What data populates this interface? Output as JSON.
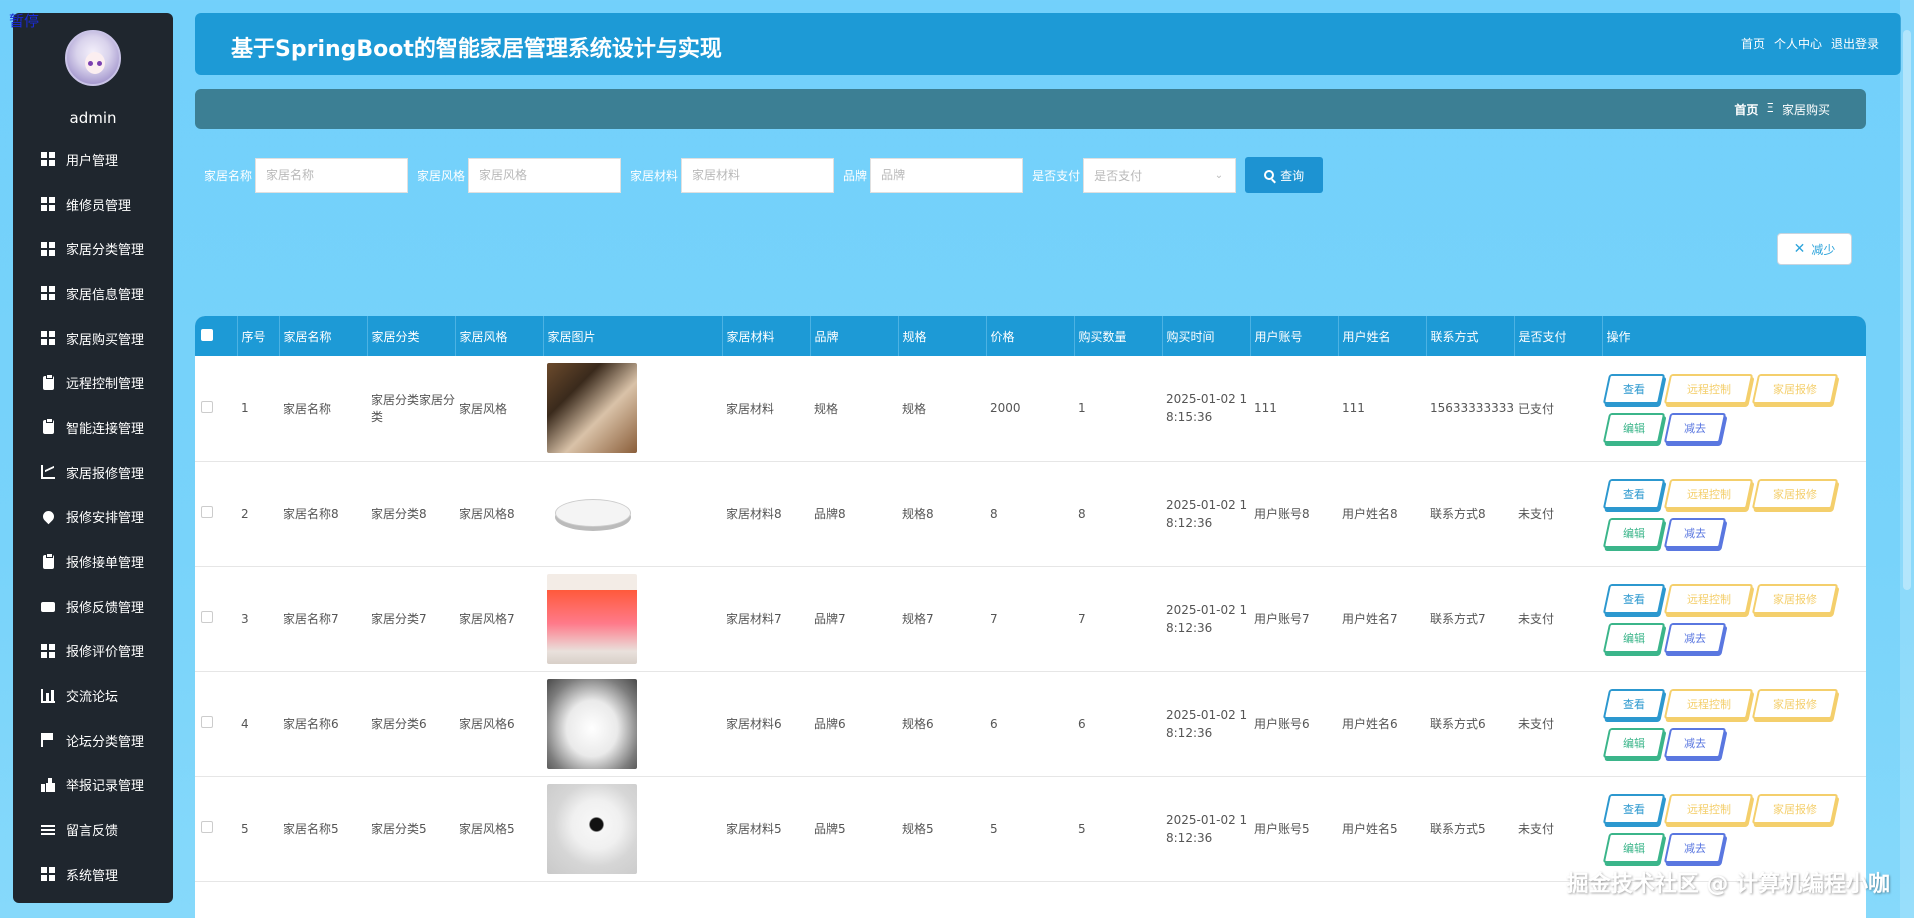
{
  "pause_label": "暂停",
  "user": {
    "name": "admin"
  },
  "menu": [
    {
      "label": "用户管理",
      "icon": "grid-icon"
    },
    {
      "label": "维修员管理",
      "icon": "grid-icon"
    },
    {
      "label": "家居分类管理",
      "icon": "grid-icon"
    },
    {
      "label": "家居信息管理",
      "icon": "grid-icon"
    },
    {
      "label": "家居购买管理",
      "icon": "grid-icon"
    },
    {
      "label": "远程控制管理",
      "icon": "clipboard-icon"
    },
    {
      "label": "智能连接管理",
      "icon": "clipboard-icon"
    },
    {
      "label": "家居报修管理",
      "icon": "chart-icon"
    },
    {
      "label": "报修安排管理",
      "icon": "pin-icon"
    },
    {
      "label": "报修接单管理",
      "icon": "clipboard-icon"
    },
    {
      "label": "报修反馈管理",
      "icon": "print-icon"
    },
    {
      "label": "报修评价管理",
      "icon": "grid-icon"
    },
    {
      "label": "交流论坛",
      "icon": "bar-chart-icon"
    },
    {
      "label": "论坛分类管理",
      "icon": "flag-icon"
    },
    {
      "label": "举报记录管理",
      "icon": "thumb-icon"
    },
    {
      "label": "留言反馈",
      "icon": "list-icon"
    },
    {
      "label": "系统管理",
      "icon": "grid-icon"
    }
  ],
  "header": {
    "title": "基于SpringBoot的智能家居管理系统设计与实现",
    "links": {
      "home": "首页",
      "profile": "个人中心",
      "logout": "退出登录"
    }
  },
  "breadcrumb": {
    "home": "首页",
    "separator": "Ξ",
    "current": "家居购买"
  },
  "search": {
    "fields": [
      {
        "label": "家居名称",
        "placeholder": "家居名称"
      },
      {
        "label": "家居风格",
        "placeholder": "家居风格"
      },
      {
        "label": "家居材料",
        "placeholder": "家居材料"
      },
      {
        "label": "品牌",
        "placeholder": "品牌"
      }
    ],
    "paid_label": "是否支付",
    "paid_placeholder": "是否支付",
    "query_button": "查询"
  },
  "reduce_button": "减少",
  "table": {
    "headers": [
      "序号",
      "家居名称",
      "家居分类",
      "家居风格",
      "家居图片",
      "家居材料",
      "品牌",
      "规格",
      "价格",
      "购买数量",
      "购买时间",
      "用户账号",
      "用户姓名",
      "联系方式",
      "是否支付",
      "操作"
    ],
    "rows": [
      {
        "idx": "1",
        "name": "家居名称",
        "category": "家居分类家居分类",
        "style": "家居风格",
        "image": "speaker",
        "material": "家居材料",
        "brand": "规格",
        "spec": "规格",
        "price": "2000",
        "qty": "1",
        "time_line1": "2025-01-02 1",
        "time_line2": "8:15:36",
        "account": "111",
        "username": "111",
        "contact": "15633333333",
        "paid": "已支付"
      },
      {
        "idx": "2",
        "name": "家居名称8",
        "category": "家居分类8",
        "style": "家居风格8",
        "image": "toilet-seat",
        "material": "家居材料8",
        "brand": "品牌8",
        "spec": "规格8",
        "price": "8",
        "qty": "8",
        "time_line1": "2025-01-02 1",
        "time_line2": "8:12:36",
        "account": "用户账号8",
        "username": "用户姓名8",
        "contact": "联系方式8",
        "paid": "未支付"
      },
      {
        "idx": "3",
        "name": "家居名称7",
        "category": "家居分类7",
        "style": "家居风格7",
        "image": "tv",
        "material": "家居材料7",
        "brand": "品牌7",
        "spec": "规格7",
        "price": "7",
        "qty": "7",
        "time_line1": "2025-01-02 1",
        "time_line2": "8:12:36",
        "account": "用户账号7",
        "username": "用户姓名7",
        "contact": "联系方式7",
        "paid": "未支付"
      },
      {
        "idx": "4",
        "name": "家居名称6",
        "category": "家居分类6",
        "style": "家居风格6",
        "image": "massager",
        "material": "家居材料6",
        "brand": "品牌6",
        "spec": "规格6",
        "price": "6",
        "qty": "6",
        "time_line1": "2025-01-02 1",
        "time_line2": "8:12:36",
        "account": "用户账号6",
        "username": "用户姓名6",
        "contact": "联系方式6",
        "paid": "未支付"
      },
      {
        "idx": "5",
        "name": "家居名称5",
        "category": "家居分类5",
        "style": "家居风格5",
        "image": "camera",
        "material": "家居材料5",
        "brand": "品牌5",
        "spec": "规格5",
        "price": "5",
        "qty": "5",
        "time_line1": "2025-01-02 1",
        "time_line2": "8:12:36",
        "account": "用户账号5",
        "username": "用户姓名5",
        "contact": "联系方式5",
        "paid": "未支付"
      }
    ],
    "actions": {
      "view": "查看",
      "remote": "远程控制",
      "repair": "家居报修",
      "edit": "编辑",
      "reduce": "减去"
    }
  },
  "watermark": "掘金技术社区 @ 计算机编程小咖",
  "colors": {
    "header": "#1d9ad6",
    "sidebar": "#1f262e",
    "breadbar": "#3c7f94",
    "background": "#72d0fb"
  }
}
